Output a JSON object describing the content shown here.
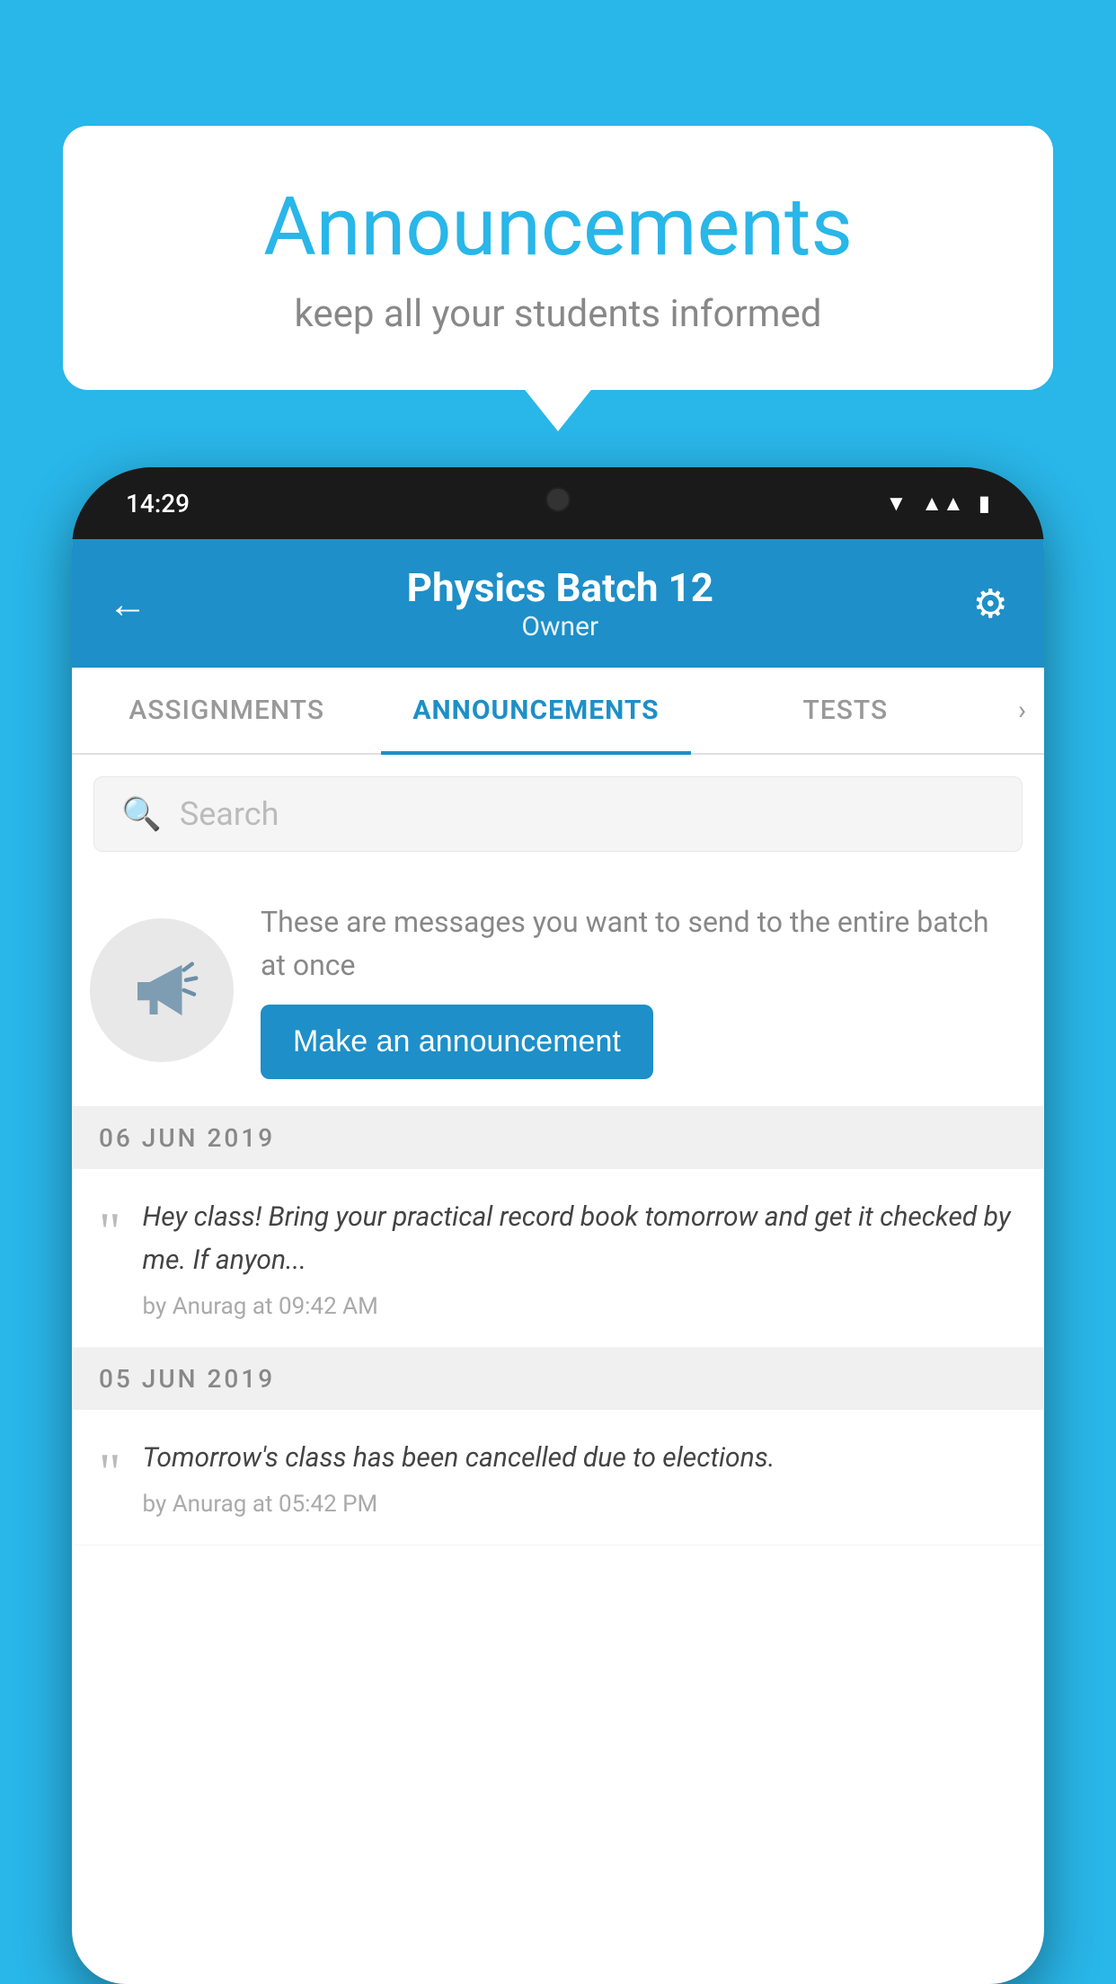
{
  "background_color": "#29b6e8",
  "speech_bubble": {
    "title": "Announcements",
    "subtitle": "keep all your students informed"
  },
  "phone": {
    "status_bar": {
      "time": "14:29"
    },
    "header": {
      "title": "Physics Batch 12",
      "subtitle": "Owner",
      "back_label": "←",
      "gear_label": "⚙"
    },
    "tabs": [
      {
        "label": "ASSIGNMENTS",
        "active": false
      },
      {
        "label": "ANNOUNCEMENTS",
        "active": true
      },
      {
        "label": "TESTS",
        "active": false
      }
    ],
    "search": {
      "placeholder": "Search"
    },
    "promo": {
      "description_text": "These are messages you want to send to the entire batch at once",
      "button_label": "Make an announcement"
    },
    "announcements": [
      {
        "date": "06  JUN  2019",
        "messages": [
          {
            "text": "Hey class! Bring your practical record book tomorrow and get it checked by me. If anyon...",
            "meta": "by Anurag at 09:42 AM"
          }
        ]
      },
      {
        "date": "05  JUN  2019",
        "messages": [
          {
            "text": "Tomorrow's class has been cancelled due to elections.",
            "meta": "by Anurag at 05:42 PM"
          }
        ]
      }
    ]
  }
}
